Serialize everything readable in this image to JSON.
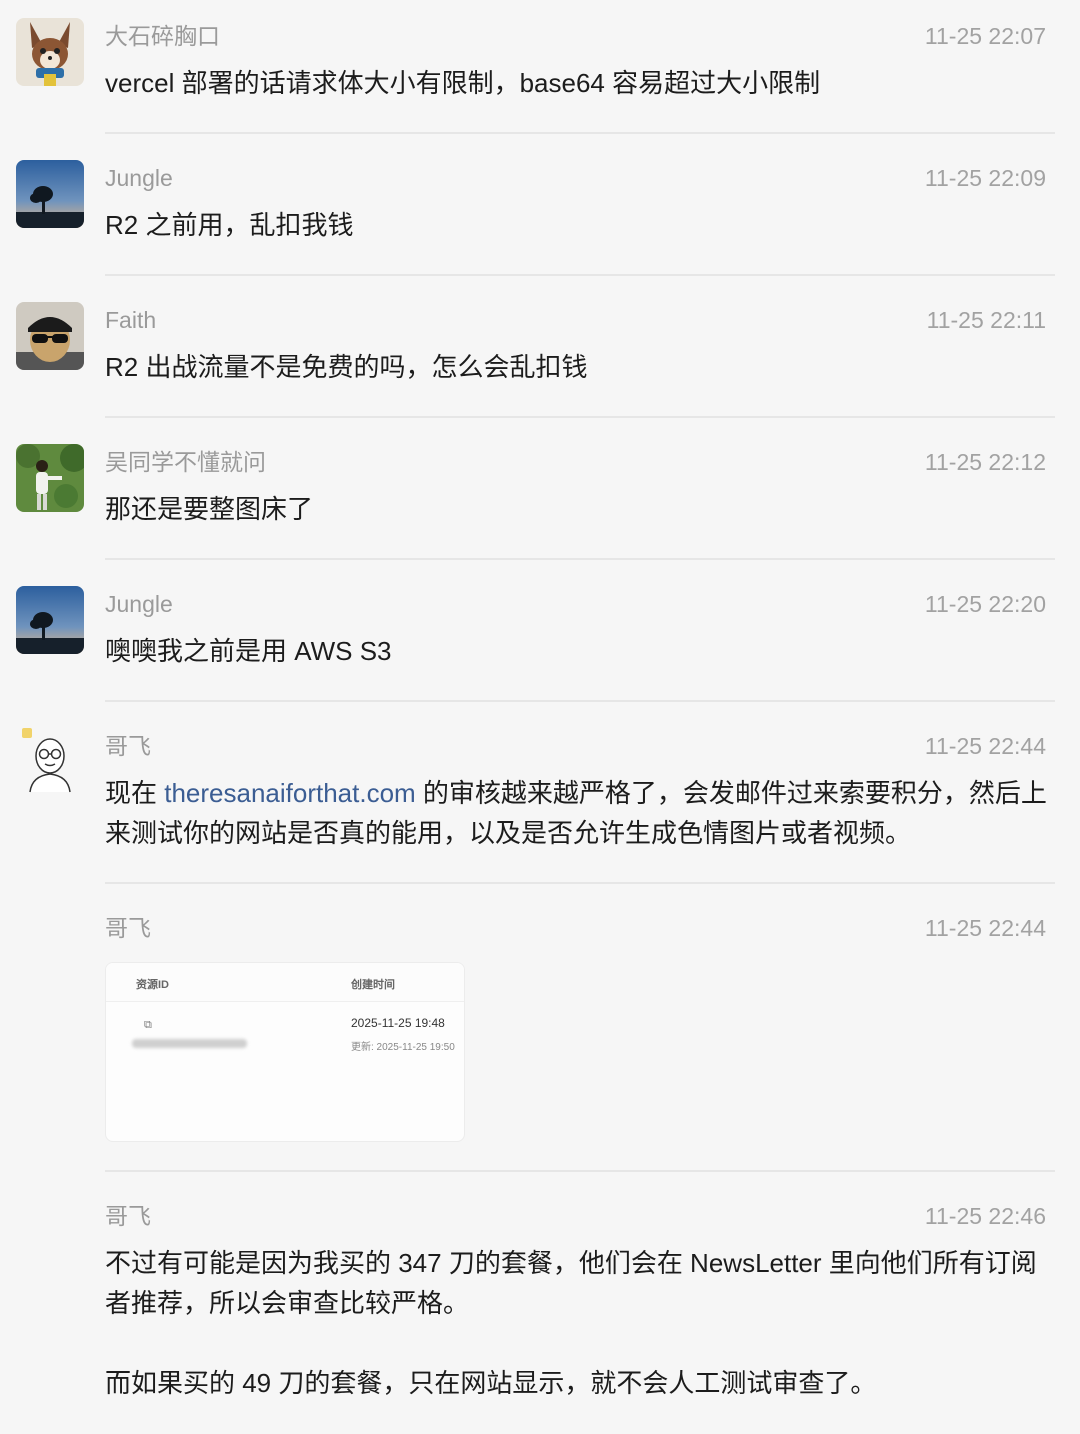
{
  "messages": [
    {
      "name": "大石碎胸口",
      "time": "11-25 22:07",
      "text": "vercel 部署的话请求体大小有限制，base64 容易超过大小限制",
      "avatar_icon": "fox-character-icon"
    },
    {
      "name": "Jungle",
      "time": "11-25 22:09",
      "text": "R2 之前用，乱扣我钱",
      "avatar_icon": "sunset-tree-icon"
    },
    {
      "name": "Faith",
      "time": "11-25 22:11",
      "text": "R2 出战流量不是免费的吗，怎么会乱扣钱",
      "avatar_icon": "sunglasses-face-icon"
    },
    {
      "name": "吴同学不懂就问",
      "time": "11-25 22:12",
      "text": "那还是要整图床了",
      "avatar_icon": "person-outdoors-icon"
    },
    {
      "name": "Jungle",
      "time": "11-25 22:20",
      "text": "噢噢我之前是用 AWS S3",
      "avatar_icon": "sunset-tree-icon"
    },
    {
      "name": "哥飞",
      "time": "11-25 22:44",
      "text_before": "现在 ",
      "link": "theresanaiforthat.com",
      "text_after": " 的审核越来越严格了，会发邮件过来索要积分，然后上来测试你的网站是否真的能用，以及是否允许生成色情图片或者视频。",
      "avatar_icon": "glasses-man-sketch-icon"
    },
    {
      "name": "哥飞",
      "time": "11-25 22:44",
      "image": {
        "col1": "资源ID",
        "col2": "创建时间",
        "copy_icon": "⧉",
        "created": "2025-11-25 19:48",
        "updated": "更新: 2025-11-25 19:50"
      }
    },
    {
      "name": "哥飞",
      "time": "11-25 22:46",
      "text": "不过有可能是因为我买的 347 刀的套餐，他们会在 NewsLetter 里向他们所有订阅者推荐，所以会审查比较严格。\n\n而如果买的 49 刀的套餐，只在网站显示，就不会人工测试审查了。"
    }
  ],
  "colors": {
    "background": "#f6f6f6",
    "name": "#9a9a9a",
    "text": "#1c1c1c",
    "link": "#3b5d93",
    "divider": "#e6e6e6"
  }
}
